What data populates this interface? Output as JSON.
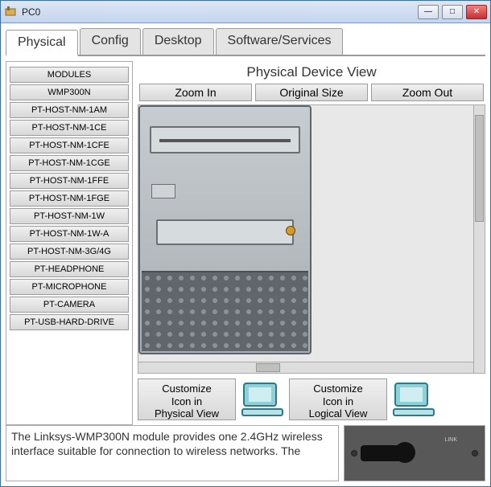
{
  "window": {
    "title": "PC0"
  },
  "tabs": {
    "physical": "Physical",
    "config": "Config",
    "desktop": "Desktop",
    "software": "Software/Services"
  },
  "modules": {
    "header": "MODULES",
    "items": [
      "WMP300N",
      "PT-HOST-NM-1AM",
      "PT-HOST-NM-1CE",
      "PT-HOST-NM-1CFE",
      "PT-HOST-NM-1CGE",
      "PT-HOST-NM-1FFE",
      "PT-HOST-NM-1FGE",
      "PT-HOST-NM-1W",
      "PT-HOST-NM-1W-A",
      "PT-HOST-NM-3G/4G",
      "PT-HEADPHONE",
      "PT-MICROPHONE",
      "PT-CAMERA",
      "PT-USB-HARD-DRIVE"
    ]
  },
  "view": {
    "title": "Physical Device View",
    "zoom_in": "Zoom In",
    "original": "Original Size",
    "zoom_out": "Zoom Out"
  },
  "customize": {
    "physical": "Customize\nIcon in\nPhysical View",
    "logical": "Customize\nIcon in\nLogical View"
  },
  "description": "The Linksys-WMP300N module provides one 2.4GHz wireless interface suitable for connection to wireless networks. The",
  "preview": {
    "label": "LINK"
  }
}
